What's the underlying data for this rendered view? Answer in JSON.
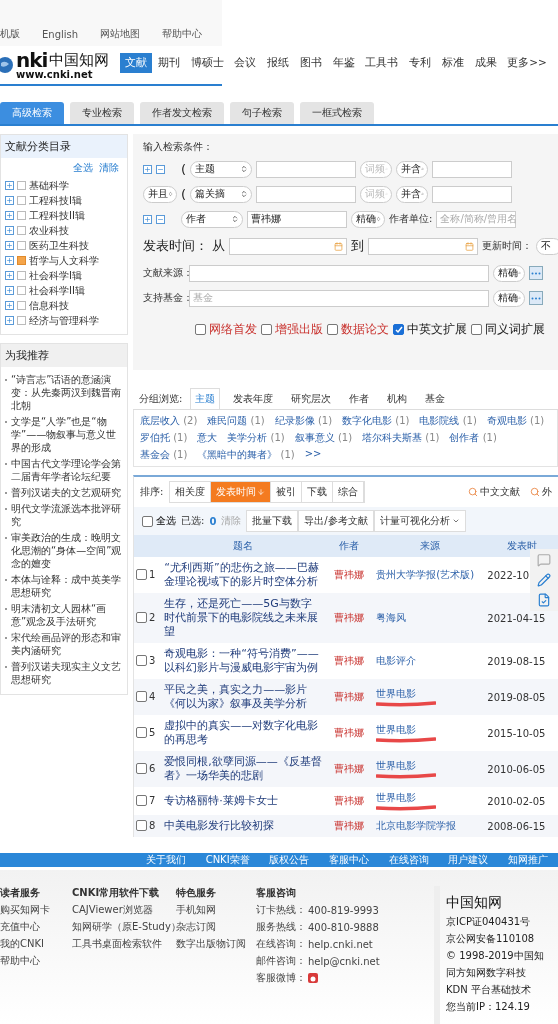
{
  "top_links": [
    "机版",
    "English",
    "网站地图",
    "帮助中心"
  ],
  "logo": {
    "mark": "nki",
    "name": "中国知网",
    "url": "www.cnki.net"
  },
  "nav": [
    {
      "label": "文献",
      "selected": true
    },
    {
      "label": "期刊",
      "selected": false
    },
    {
      "label": "博硕士",
      "selected": false
    },
    {
      "label": "会议",
      "selected": false
    },
    {
      "label": "报纸",
      "selected": false
    },
    {
      "label": "图书",
      "selected": false
    },
    {
      "label": "年鉴",
      "selected": false
    },
    {
      "label": "工具书",
      "selected": false
    },
    {
      "label": "专利",
      "selected": false
    },
    {
      "label": "标准",
      "selected": false
    },
    {
      "label": "成果",
      "selected": false
    },
    {
      "label": "更多>>",
      "selected": false
    }
  ],
  "search_tabs": [
    {
      "label": "高级检索",
      "selected": true
    },
    {
      "label": "专业检索",
      "selected": false
    },
    {
      "label": "作者发文检索",
      "selected": false
    },
    {
      "label": "句子检索",
      "selected": false
    },
    {
      "label": "一框式检索",
      "selected": false
    }
  ],
  "sidebar": {
    "title": "文献分类目录",
    "actions": [
      "全选",
      "清除"
    ],
    "items": [
      {
        "label": "基础科学",
        "checked": false
      },
      {
        "label": "工程科技I辑",
        "checked": false
      },
      {
        "label": "工程科技II辑",
        "checked": false
      },
      {
        "label": "农业科技",
        "checked": false
      },
      {
        "label": "医药卫生科技",
        "checked": false
      },
      {
        "label": "哲学与人文科学",
        "checked": true
      },
      {
        "label": "社会科学I辑",
        "checked": false
      },
      {
        "label": "社会科学II辑",
        "checked": false
      },
      {
        "label": "信息科技",
        "checked": false
      },
      {
        "label": "经济与管理科学",
        "checked": false
      }
    ]
  },
  "recommend": {
    "title": "为我推荐",
    "items": [
      "“诗言志”话语的意涵演变：从先秦两汉到魏晋南北朝",
      "文学是“人学”也是“物学”——物叙事与意义世界的形成",
      "中国古代文学理论学会第二届青年学者论坛纪要",
      "普列汉诺夫的文艺观研究",
      "明代文学流派选本批评研究",
      "审美政治的生成：晚明文化思潮的“身体—空间”观念的嬗变",
      "本体与诠释：成中英美学思想研究",
      "明末清初文人园林“画意”观念及手法研究",
      "宋代绘画品评的形态和审美内涵研究",
      "普列汉诺夫现实主义文艺思想研究"
    ]
  },
  "form": {
    "heading": "输入检索条件：",
    "conditions": [
      {
        "kind": "field",
        "paren": "(",
        "field": "主题",
        "freq": "词频",
        "match": "并含"
      },
      {
        "kind": "field",
        "logic": "并且",
        "paren": "(",
        "field": "篇关摘",
        "freq": "词频",
        "match": "并含"
      },
      {
        "kind": "author",
        "field": "作者",
        "value": "曹祎娜",
        "match": "精确",
        "unit_label": "作者单位:",
        "unit_placeholder": "全称/简称/曾用名"
      }
    ],
    "date": {
      "label": "发表时间：",
      "from": "从",
      "to": "到",
      "update_label": "更新时间：",
      "update_value": "不"
    },
    "sources": [
      {
        "label": "文献来源：",
        "match": "精确"
      },
      {
        "label": "支持基金：",
        "placeholder": "基金",
        "match": "精确"
      }
    ],
    "options": [
      {
        "label": "网络首发",
        "checked": false,
        "kind": "featured"
      },
      {
        "label": "增强出版",
        "checked": false,
        "kind": "featured"
      },
      {
        "label": "数据论文",
        "checked": false,
        "kind": "featured"
      },
      {
        "label": "中英文扩展",
        "checked": true,
        "kind": "plain"
      },
      {
        "label": "同义词扩展",
        "checked": false,
        "kind": "plain"
      }
    ]
  },
  "group": {
    "label": "分组浏览:",
    "tabs": [
      {
        "label": "主题",
        "selected": true
      },
      {
        "label": "发表年度",
        "selected": false
      },
      {
        "label": "研究层次",
        "selected": false
      },
      {
        "label": "作者",
        "selected": false
      },
      {
        "label": "机构",
        "selected": false
      },
      {
        "label": "基金",
        "selected": false
      }
    ],
    "tags": [
      {
        "label": "底层收入",
        "count": "(2)"
      },
      {
        "label": "难民问题",
        "count": "(1)"
      },
      {
        "label": "纪录影像",
        "count": "(1)"
      },
      {
        "label": "数字化电影",
        "count": "(1)"
      },
      {
        "label": "电影院线",
        "count": "(1)"
      },
      {
        "label": "奇观电影",
        "count": "(1)"
      },
      {
        "label": "罗伯托",
        "count": "(1)"
      },
      {
        "label": "意大"
      },
      {
        "label": "美学分析",
        "count": "(1)"
      },
      {
        "label": "叙事意义",
        "count": "(1)"
      },
      {
        "label": "塔尔科夫斯基",
        "count": "(1)"
      },
      {
        "label": "创作者",
        "count": "(1)"
      },
      {
        "label": "基金会",
        "count": "(1)"
      },
      {
        "label": "《黑暗中的舞者》",
        "count": "(1)"
      }
    ],
    "more": ">>"
  },
  "sort": {
    "label": "排序:",
    "options": [
      {
        "label": "相关度",
        "selected": false
      },
      {
        "label": "发表时间",
        "selected": true
      },
      {
        "label": "被引",
        "selected": false
      },
      {
        "label": "下载",
        "selected": false
      },
      {
        "label": "综合",
        "selected": false
      }
    ],
    "languages": [
      "中文文献",
      "外"
    ]
  },
  "actions": {
    "select_all": "全选",
    "select_all_checked": false,
    "selected_label": "已选:",
    "selected_count": "0",
    "clear": "清除",
    "buttons": [
      "批量下载",
      "导出/参考文献",
      "计量可视化分析"
    ]
  },
  "table": {
    "columns": [
      "题名",
      "作者",
      "来源",
      "发表时"
    ],
    "rows": [
      {
        "num": "1",
        "title": "“尤利西斯”的悲伤之旅——巴赫金理论视域下的影片时空体分析",
        "author": "曹祎娜",
        "source": "贵州大学学报(艺术版)",
        "date": "2022-10",
        "marked": false,
        "checked": false
      },
      {
        "num": "2",
        "title": "生存，还是死亡——5G与数字时代前景下的电影院线之未来展望",
        "author": "曹祎娜",
        "source": "粤海风",
        "date": "2021-04-15",
        "marked": false,
        "checked": false
      },
      {
        "num": "3",
        "title": "奇观电影：一种“符号消费”——以科幻影片与漫威电影宇宙为例",
        "author": "曹祎娜",
        "source": "电影评介",
        "date": "2019-08-15",
        "marked": false,
        "checked": false
      },
      {
        "num": "4",
        "title": "平民之美，真实之力——影片《何以为家》叙事及美学分析",
        "author": "曹祎娜",
        "source": "世界电影",
        "date": "2019-08-05",
        "marked": true,
        "checked": false
      },
      {
        "num": "5",
        "title": "虚拟中的真实——对数字化电影的再思考",
        "author": "曹祎娜",
        "source": "世界电影",
        "date": "2015-10-05",
        "marked": true,
        "checked": false
      },
      {
        "num": "6",
        "title": "爱恨同根,欲孽同源——《反基督者》一场华美的悲剧",
        "author": "曹祎娜",
        "source": "世界电影",
        "date": "2010-06-05",
        "marked": true,
        "checked": false
      },
      {
        "num": "7",
        "title": "专访格丽特·莱姆卡女士",
        "author": "曹祎娜",
        "source": "世界电影",
        "date": "2010-02-05",
        "marked": true,
        "checked": false
      },
      {
        "num": "8",
        "title": "中美电影发行比较初探",
        "author": "曹祎娜",
        "source": "北京电影学院学报",
        "date": "2008-06-15",
        "marked": false,
        "checked": false
      }
    ]
  },
  "footer": {
    "links": [
      "关于我们",
      "CNKI荣誉",
      "版权公告",
      "客服中心",
      "在线咨询",
      "用户建议",
      "知网推广"
    ],
    "columns": [
      {
        "title": "读者服务",
        "items": [
          "购买知网卡",
          "充值中心",
          "我的CNKI",
          "帮助中心"
        ]
      },
      {
        "title": "CNKI常用软件下载",
        "items": [
          "CAJViewer浏览器",
          "知网研学（原E-Study）",
          "工具书桌面检索软件"
        ]
      },
      {
        "title": "特色服务",
        "items": [
          "手机知网",
          "杂志订阅",
          "数字出版物订阅"
        ]
      }
    ],
    "contact": {
      "title": "客服咨询",
      "rows": [
        {
          "label": "订卡热线：",
          "value": "400-819-9993"
        },
        {
          "label": "服务热线：",
          "value": "400-810-9888"
        },
        {
          "label": "在线咨询：",
          "value": "help.cnki.net"
        },
        {
          "label": "邮件咨询：",
          "value": "help@cnki.net"
        },
        {
          "label": "客服微博："
        }
      ]
    },
    "brand": {
      "name": "中国知网",
      "lines": [
        "京ICP证040431号",
        "京公网安备110108",
        "© 1998-2019中国知",
        "同方知网数字科技",
        "KDN 平台基础技术",
        "您当前IP：124.19"
      ]
    }
  }
}
